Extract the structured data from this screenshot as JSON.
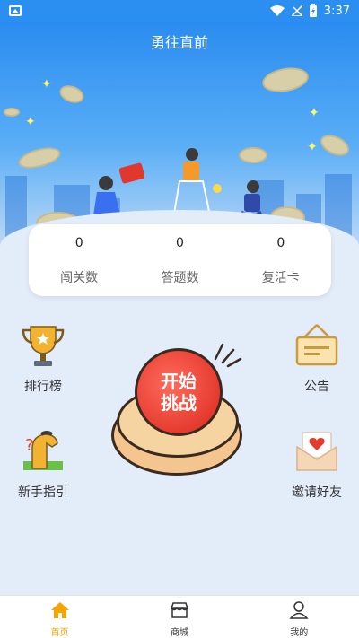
{
  "status": {
    "time": "3:37"
  },
  "header": {
    "title": "勇往直前"
  },
  "stats": [
    {
      "value": "0",
      "label": "闯关数"
    },
    {
      "value": "0",
      "label": "答题数"
    },
    {
      "value": "0",
      "label": "复活卡"
    }
  ],
  "features": {
    "ranking": "排行榜",
    "announcement": "公告",
    "guide": "新手指引",
    "invite": "邀请好友"
  },
  "start_button": {
    "line1": "开始",
    "line2": "挑战"
  },
  "tabbar": [
    {
      "label": "首页",
      "icon": "home-icon",
      "active": true
    },
    {
      "label": "商城",
      "icon": "store-icon",
      "active": false
    },
    {
      "label": "我的",
      "icon": "user-icon",
      "active": false
    }
  ],
  "colors": {
    "accent": "#f6a400",
    "header": "#2b8ff2",
    "start": "#e53b2f"
  }
}
